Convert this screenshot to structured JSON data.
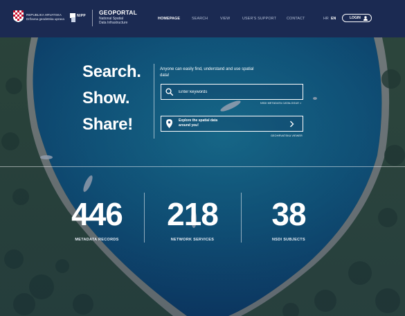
{
  "header": {
    "org_line1": "REPUBLIKA HRVATSKA",
    "org_line2": "Državna geodetska uprava",
    "nipp_label": "NIPP",
    "geoportal_title": "GEOPORTAL",
    "geoportal_sub1": "National Spatial",
    "geoportal_sub2": "Data Infrastructure",
    "nav": [
      {
        "label": "HOMEPAGE",
        "active": true
      },
      {
        "label": "SEARCH"
      },
      {
        "label": "VIEW"
      },
      {
        "label": "USER'S SUPPORT"
      },
      {
        "label": "CONTACT"
      }
    ],
    "languages": [
      "HR",
      "EN"
    ],
    "active_language": "EN",
    "login_label": "LOGIN"
  },
  "hero": {
    "tagline": [
      "Search.",
      "Show.",
      "Share!"
    ],
    "intro": "Anyone can easily find, understand and use spatial data!",
    "search_placeholder": "Enter keywords",
    "catalogue_link": "NSDI METADATA CATALOGUE >",
    "explore_line1": "Explore the spatial data",
    "explore_line2": "around you!",
    "viewer_link": "GEOHRVATSKA VIEWER"
  },
  "stats": [
    {
      "number": "446",
      "label": "METADATA RECORDS"
    },
    {
      "number": "218",
      "label": "NETWORK SERVICES"
    },
    {
      "number": "38",
      "label": "NSDI SUBJECTS"
    }
  ],
  "colors": {
    "header_bg": "#1b2a52",
    "sea_deep": "#0d3f6e",
    "sea_light": "#1b8fae",
    "land": "#3f5b38",
    "shore": "#b9b4a4"
  }
}
